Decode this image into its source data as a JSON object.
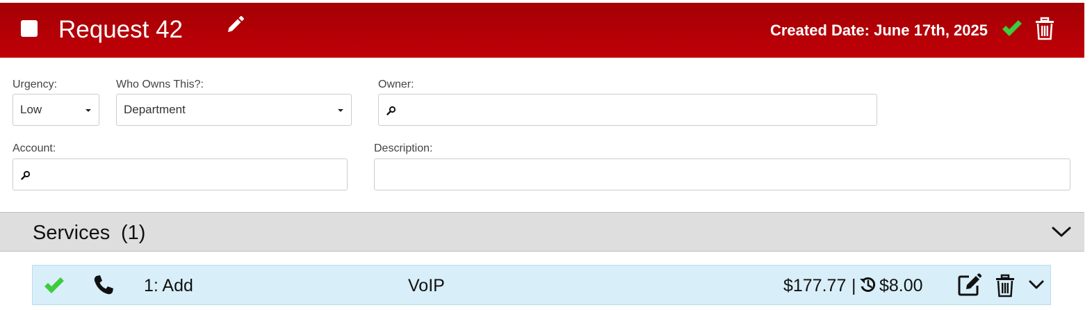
{
  "header": {
    "title": "Request 42",
    "created_date": "Created Date: June 17th, 2025",
    "background_color": "#b00006",
    "check_color": "#3dcc3d"
  },
  "form": {
    "urgency": {
      "label": "Urgency:",
      "value": "Low"
    },
    "ownership": {
      "label": "Who Owns This?:",
      "value": "Department"
    },
    "owner": {
      "label": "Owner:",
      "value": ""
    },
    "account": {
      "label": "Account:",
      "value": ""
    },
    "description": {
      "label": "Description:",
      "value": ""
    }
  },
  "services": {
    "title": "Services",
    "count": "(1)",
    "items": [
      {
        "number": "1: Add",
        "type": "VoIP",
        "price": "$177.77",
        "separator": "|",
        "monthly": "$8.00",
        "icons": [
          "check-icon",
          "phone-icon",
          "history-icon",
          "edit-icon",
          "trash-icon",
          "chevron-down-icon"
        ]
      }
    ]
  }
}
